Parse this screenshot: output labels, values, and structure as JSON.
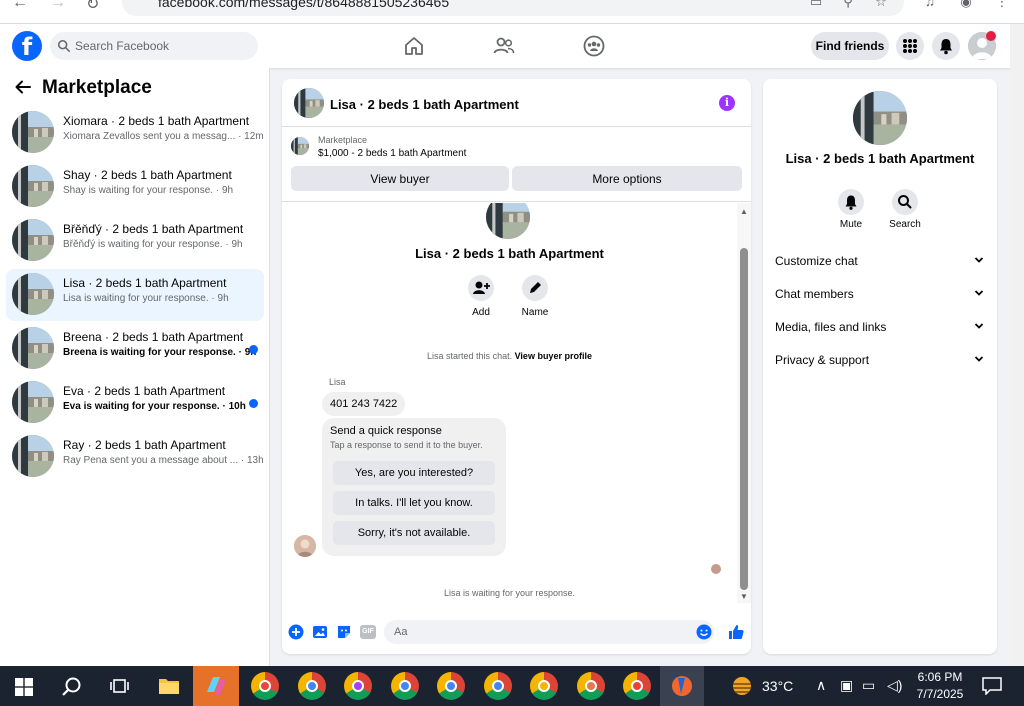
{
  "browser": {
    "url": "facebook.com/messages/t/8648881505236465"
  },
  "header": {
    "search_placeholder": "Search Facebook",
    "find_friends_label": "Find friends",
    "accent": "#0866ff"
  },
  "left": {
    "title": "Marketplace",
    "conversations": [
      {
        "name": "Xiomara · 2 beds 1 bath Apartment",
        "preview": "Xiomara Zevallos sent you a messag... · 12m",
        "unread": false
      },
      {
        "name": "Shay · 2 beds 1 bath Apartment",
        "preview": "Shay is waiting for your response. · 9h",
        "unread": false
      },
      {
        "name": "Břěňďý · 2 beds 1 bath Apartment",
        "preview": "Břěňďý is waiting for your response. · 9h",
        "unread": false
      },
      {
        "name": "Lisa · 2 beds 1 bath Apartment",
        "preview": "Lisa is waiting for your response. · 9h",
        "unread": false,
        "active": true
      },
      {
        "name": "Breena · 2 beds 1 bath Apartment",
        "preview": "Breena is waiting for your response. · 9h",
        "unread": true
      },
      {
        "name": "Eva · 2 beds 1 bath Apartment",
        "preview": "Eva is waiting for your response. · 10h",
        "unread": true
      },
      {
        "name": "Ray · 2 beds 1 bath Apartment",
        "preview": "Ray Pena sent you a message about ... · 13h",
        "unread": false
      }
    ]
  },
  "chat": {
    "title": "Lisa · 2 beds 1 bath Apartment",
    "listing_label": "Marketplace",
    "listing_price": "$1,000 - 2 beds 1 bath Apartment",
    "view_buyer_label": "View buyer",
    "more_options_label": "More options",
    "add_label": "Add",
    "name_label": "Name",
    "started_text": "Lisa started this chat.",
    "view_profile_link": "View buyer profile",
    "sender_name": "Lisa",
    "phone_message": "401 243 7422",
    "quick_title": "Send a quick response",
    "quick_subtitle": "Tap a response to send it to the buyer.",
    "quick_replies": [
      "Yes, are you interested?",
      "In talks. I'll let you know.",
      "Sorry, it's not available."
    ],
    "waiting_text": "Lisa is waiting for your response.",
    "input_placeholder": "Aa",
    "gif_label": "GIF"
  },
  "right": {
    "title": "Lisa · 2 beds 1 bath Apartment",
    "mute_label": "Mute",
    "search_label": "Search",
    "sections": [
      "Customize chat",
      "Chat members",
      "Media, files and links",
      "Privacy & support"
    ]
  },
  "taskbar": {
    "temperature": "33°C",
    "time": "6:06 PM",
    "date": "7/7/2025"
  }
}
